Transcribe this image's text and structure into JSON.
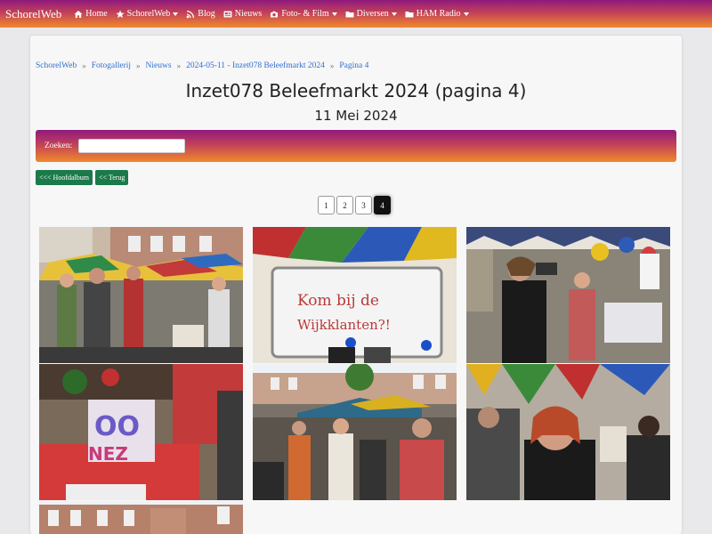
{
  "navbar": {
    "brand": "SchorelWeb",
    "items": [
      {
        "label": "Home",
        "icon": "home-icon",
        "dropdown": false
      },
      {
        "label": "SchorelWeb",
        "icon": "star-icon",
        "dropdown": true
      },
      {
        "label": "Blog",
        "icon": "rss-icon",
        "dropdown": false
      },
      {
        "label": "Nieuws",
        "icon": "newspaper-icon",
        "dropdown": false
      },
      {
        "label": "Foto- & Film",
        "icon": "camera-icon",
        "dropdown": true
      },
      {
        "label": "Diversen",
        "icon": "folder-icon",
        "dropdown": true
      },
      {
        "label": "HAM Radio",
        "icon": "folder-icon",
        "dropdown": true
      }
    ]
  },
  "breadcrumb": [
    "SchorelWeb",
    "Fotogallerij",
    "Nieuws",
    "2024-05-11 - Inzet078 Beleefmarkt 2024",
    "Pagina 4"
  ],
  "page": {
    "title": "Inzet078 Beleefmarkt 2024 (pagina 4)",
    "date": "11 Mei 2024"
  },
  "search": {
    "label": "Zoeken:",
    "value": "",
    "placeholder": ""
  },
  "buttons": {
    "main_album": "<<< Hoofdalbum",
    "back": "<< Terug"
  },
  "pagination": {
    "pages": [
      "1",
      "2",
      "3",
      "4"
    ],
    "current": "4"
  },
  "colors": {
    "nav_gradient_top": "#8e1a7d",
    "nav_gradient_bottom": "#f08a2a",
    "link": "#2f6fd1",
    "button_green": "#1b7a4a"
  },
  "photos": [
    "market-stalls-photo",
    "whiteboard-photo",
    "people-filming-photo",
    "zen-sign-photo",
    "square-crowd-photo",
    "woman-in-crowd-photo",
    "building-photo"
  ]
}
